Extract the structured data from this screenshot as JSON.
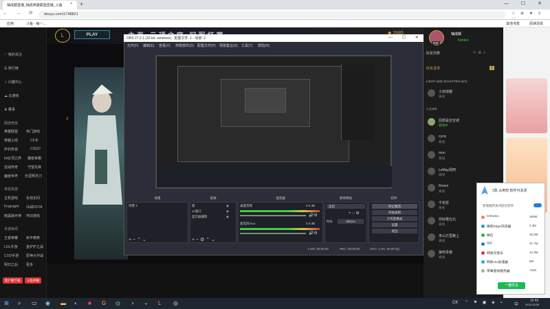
{
  "browser": {
    "tab_title": "柚成都直播_柚成英雄联盟直播_斗鱼",
    "tab_close": "×",
    "new_tab": "+",
    "window_controls": "— ☐ ✕",
    "nav": "← → ⟳ ⌂",
    "url": "douyu.com/1748821",
    "tools": "☆ ⊕ ★ ≡ ⋯",
    "bookmarks": [
      {
        "label": "应用"
      },
      {
        "label": "斗鱼 - 每一…"
      },
      {
        "label": "其他书签"
      },
      {
        "label": "阅读清单"
      }
    ]
  },
  "site": {
    "left_nav": [
      {
        "label": "我的关注",
        "icon": "heart-icon"
      },
      {
        "label": "排行榜",
        "icon": "list-icon"
      },
      {
        "label": "兴趣中心",
        "icon": "star-icon"
      },
      {
        "label": "云游戏",
        "icon": "cloud-icon"
      },
      {
        "label": "赛事",
        "icon": "trophy-icon"
      }
    ],
    "categories": [
      {
        "header": "网游竞技",
        "items": [
          "英雄联盟",
          "热门游戏",
          "穿越火线",
          "CF手",
          "炉石传说",
          "CSGO",
          "lol云顶之弈",
          "魔兽争霸",
          "逆战传奇",
          "守望先锋",
          "魔兽世界",
          "天涯明月刀"
        ]
      },
      {
        "header": "单机热游",
        "items": [
          "主机游戏",
          "永劫无间",
          "Fropnight",
          "冰战DOTA",
          "暗黑破坏神",
          "怀旧游戏"
        ]
      },
      {
        "header": "手游休闲",
        "items": [
          "王者荣耀",
          "和平精英",
          "LOL手游",
          "金铲铲之战",
          "COD手游",
          "原神大作战",
          "明日之后",
          "更多"
        ]
      }
    ],
    "bottom_buttons": [
      {
        "label": "客户端下载"
      },
      {
        "label": "斗鱼开播"
      }
    ],
    "play_label": "PLAY",
    "lol_logo": "L",
    "game_tabs": "主页  云顶之弈  冠军杯赛",
    "top_right": {
      "coins": "2685"
    }
  },
  "obs": {
    "title": "OBS 27.2.1 (32-bit, windows) - 配置文件: 1 - 场景: 2",
    "window_controls": "— ☐ ✕",
    "menu": [
      "文件(F)",
      "编辑(E)",
      "查看(V)",
      "停靠部件(D)",
      "配置文件(P)",
      "场景集合(S)",
      "工具(T)",
      "帮助(H)"
    ],
    "docks": {
      "scenes": {
        "header": "场景",
        "items": [
          "场景 3"
        ]
      },
      "sources": {
        "header": "来源",
        "items": [
          "窗",
          "1c窗口",
          "显示器捕获"
        ]
      },
      "mixer": {
        "header": "混音器",
        "channels": [
          {
            "name": "桌面音频",
            "db": "0.0 dB"
          },
          {
            "name": "麦克风/Aux",
            "db": "0.0 dB"
          }
        ]
      },
      "transitions": {
        "header": "转场特效",
        "type": "淡出",
        "duration_label": "时长",
        "duration": "300ms"
      },
      "controls": {
        "header": "控件",
        "buttons": [
          "停止推流",
          "开始录制",
          "工作室模式",
          "设置",
          "退出"
        ]
      }
    },
    "status": {
      "live": "LIVE: 00:00:00",
      "rec": "REC: 00:00:00",
      "cpu": "CPU: 1.4%, 60.00 fps"
    }
  },
  "right_panel": {
    "user_name": "柚成郁",
    "user_sub": "Kohlen",
    "level": "843",
    "friends_title": "好友列表",
    "friend_requests": "好友请求",
    "request_count": "1",
    "group1": "LICHT UND SCHATTEN (0/1)",
    "group2": "1 (1/40)",
    "friends": [
      {
        "name": "小叔成都",
        "status": "离线"
      },
      {
        "name": "回想是全空城",
        "status": "游戏中"
      },
      {
        "name": "cynic",
        "status": "离线"
      },
      {
        "name": "mon",
        "status": "离线"
      },
      {
        "name": "LeMay翊珂",
        "status": "离线"
      },
      {
        "name": "Rosen",
        "status": "离线"
      },
      {
        "name": "千祈愿",
        "status": "离线"
      },
      {
        "name": "你好橙在北",
        "status": "离线"
      },
      {
        "name": "未山万里路上",
        "status": "离线"
      },
      {
        "name": "狼吻青春",
        "status": "离线"
      }
    ]
  },
  "tray": {
    "title": "1款 占用较 软件可关闭",
    "subtitle": "智能推荐关闭后台软件",
    "apps": [
      {
        "name": "Chrome…",
        "value": "260M",
        "color": "#e84"
      },
      {
        "name": "微软Edge浏览器",
        "value": "2.3M",
        "color": "#29c"
      },
      {
        "name": "微信",
        "value": "35.5M",
        "color": "#2b2"
      },
      {
        "name": "QQ",
        "value": "37.7M",
        "color": "#27c"
      },
      {
        "name": "网易云音乐",
        "value": "12.3M",
        "color": "#d33"
      },
      {
        "name": "网易UU加速器",
        "value": "5M",
        "color": "#3ad"
      },
      {
        "name": "苹果驱动服务器",
        "value": "724K",
        "color": "#aaa"
      }
    ],
    "action": "一键优化"
  },
  "taskbar": {
    "time": "12:43",
    "date": "2021/12/28",
    "lang": "中",
    "ime": "CK"
  }
}
